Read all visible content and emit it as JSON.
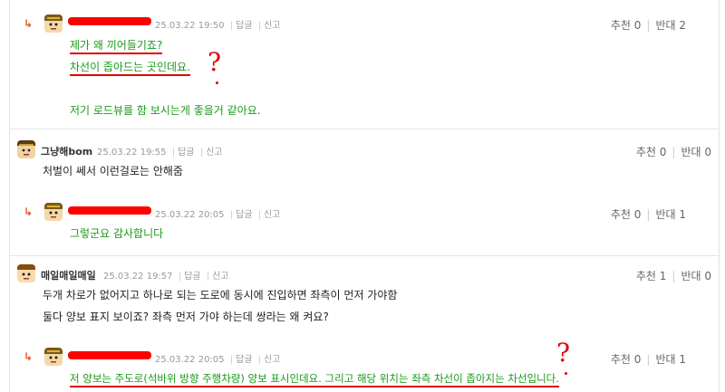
{
  "comments": [
    {
      "meta": {
        "date": "25.03.22 19:50",
        "reply": "답글",
        "report": "신고"
      },
      "votes": {
        "up_label": "추천",
        "up": "0",
        "down_label": "반대",
        "down": "2"
      },
      "lines": [
        "제가 왜 끼어들기죠?",
        "차선이 좁아드는 곳인데요.",
        "저기 로드뷰를 함 보시는게 좋을거 같아요."
      ]
    },
    {
      "author": "그냥해bom",
      "meta": {
        "date": "25.03.22 19:55",
        "reply": "답글",
        "report": "신고"
      },
      "votes": {
        "up_label": "추천",
        "up": "0",
        "down_label": "반대",
        "down": "0"
      },
      "lines": [
        "처벌이 쎄서 이런걸로는 안해줌"
      ]
    },
    {
      "meta": {
        "date": "25.03.22 20:05",
        "reply": "답글",
        "report": "신고"
      },
      "votes": {
        "up_label": "추천",
        "up": "0",
        "down_label": "반대",
        "down": "1"
      },
      "lines": [
        "그렇군요 감사합니다"
      ]
    },
    {
      "author": "매일매일매일",
      "meta": {
        "date": "25.03.22 19:57",
        "reply": "답글",
        "report": "신고"
      },
      "votes": {
        "up_label": "추천",
        "up": "1",
        "down_label": "반대",
        "down": "0"
      },
      "lines": [
        "두개 차로가 없어지고 하나로 되는 도로에 동시에 진입하면 좌측이 먼저 가야함",
        "둘다 양보 표지 보이죠? 좌측 먼저 가야 하는데 쌍라는 왜 켜요?"
      ]
    },
    {
      "meta": {
        "date": "25.03.22 20:05",
        "reply": "답글",
        "report": "신고"
      },
      "votes": {
        "up_label": "추천",
        "up": "0",
        "down_label": "반대",
        "down": "1"
      },
      "lines": [
        "저 양보는 주도로(석바위 방향 주행차량) 양보 표시인데요. 그리고 해당 위치는 좌측 차선이 좁아지는 차선입니다."
      ]
    }
  ],
  "icons": {
    "reply_arrow": "reply-arrow-icon",
    "avatar": "avatar-icon"
  },
  "colors": {
    "reply_text": "#1a9a1a",
    "accent": "#e8551f",
    "annotation": "#e00000"
  }
}
